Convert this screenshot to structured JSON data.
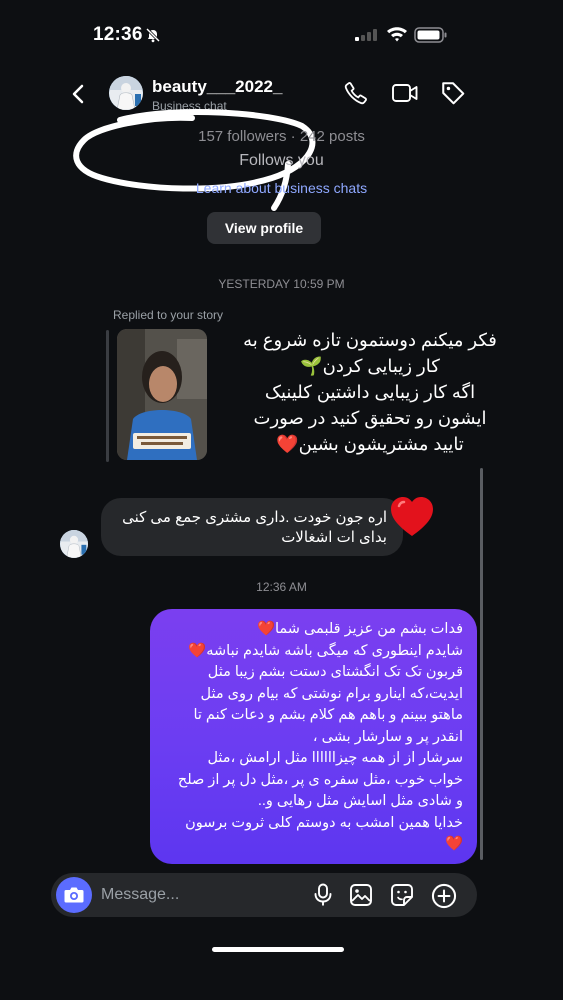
{
  "status_bar": {
    "time": "12:36",
    "icons": [
      "bell-slash-icon",
      "signal-icon",
      "wifi-icon",
      "battery-icon"
    ]
  },
  "header": {
    "username": "beauty___2022_",
    "subtitle": "Business chat",
    "actions": [
      "phone-icon",
      "video-call-icon",
      "tag-icon"
    ]
  },
  "profile": {
    "stats": "157 followers · 242 posts",
    "follows": "Follows you",
    "learn_link": "Learn about business chats",
    "view_profile": "View profile"
  },
  "thread": {
    "timestamp_1": "YESTERDAY 10:59 PM",
    "reply_label": "Replied to your story",
    "story_caption": "فکر میکنم دوستمون تازه شروع به\nکار زیبایی کردن🌱\nاگه کار زیبایی داشتین کلینیک\nایشون رو تحقیق کنید در صورت\nتایید مشتریشون بشین❤️",
    "incoming_message": "اره جون خودت .داری مشتری جمع می کنی\nبدای ات اشغالات",
    "reaction": "❤️",
    "timestamp_2": "12:36 AM",
    "outgoing_message": "فدات بشم من عزیز قلبمی شما❤️\nشایدم اینطوری که میگی باشه شایدم نباشه❤️\nقربون تک تک انگشتای دستت بشم زیبا مثل\nایدیت،که اینارو برام نوشتی  که بیام روی مثل\nماهتو ببینم و باهم هم کلام بشم و دعات کنم تا\nانقدر پر و سارشار  بشی ،\nسرشار از از همه چیزاااااا مثل ارامش ،مثل\nخواب خوب ،مثل سفره ی پر ،مثل دل پر از صلح\nو شادی مثل اسایش مثل رهایی و..\nخدایا همین امشب به دوستم کلی ثروت برسون\n❤️"
  },
  "composer": {
    "placeholder": "Message...",
    "icons": [
      "camera-icon",
      "microphone-icon",
      "image-icon",
      "sticker-icon",
      "plus-icon"
    ]
  },
  "colors": {
    "background": "#0d0f12",
    "outgoing_bubble": "#6b3df2",
    "incoming_bubble": "#26282b",
    "link": "#8fa8ff"
  }
}
